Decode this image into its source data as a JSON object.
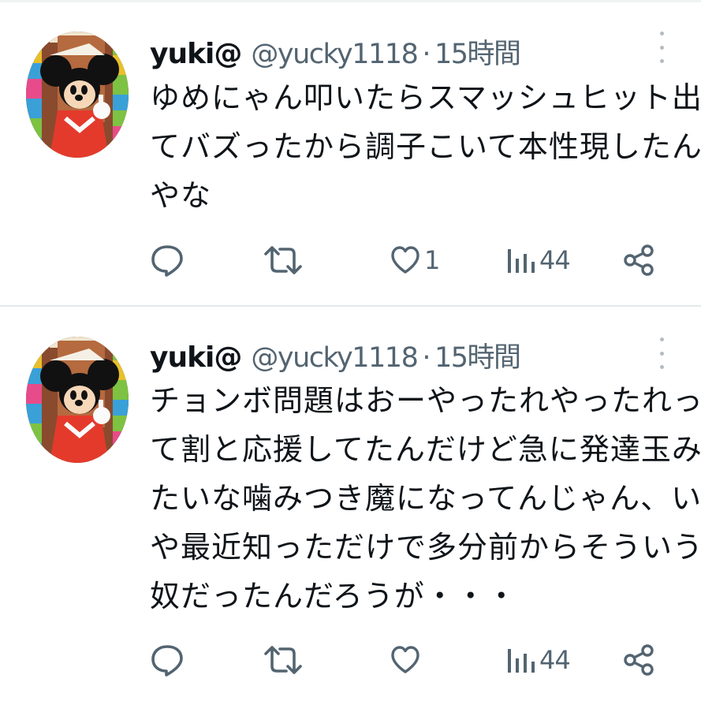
{
  "tweets": [
    {
      "author_name": "yuki@",
      "handle": "@yucky1118",
      "separator": "·",
      "time": "15時間",
      "lines": [
        "ゆめにゃん叩いたらスマッシュヒット出",
        "てバズったから調子こいて本性現したん",
        "やな"
      ],
      "reply_count": "",
      "retweet_count": "",
      "like_count": "1",
      "view_count": "44"
    },
    {
      "author_name": "yuki@",
      "handle": "@yucky1118",
      "separator": "·",
      "time": "15時間",
      "lines": [
        "チョンボ問題はおーやったれやったれっ",
        "て割と応援してたんだけど急に発達玉み",
        "たいな噛みつき魔になってんじゃん、い",
        "や最近知っただけで多分前からそういう",
        "奴だったんだろうが・・・"
      ],
      "reply_count": "",
      "retweet_count": "",
      "like_count": "",
      "view_count": "44"
    }
  ],
  "icons": {
    "reply": "speech-bubble-icon",
    "retweet": "retweet-arrows-icon",
    "like": "heart-icon",
    "views": "bar-chart-icon",
    "share": "share-icon",
    "more": "vertical-dots-icon"
  },
  "colors": {
    "text": "#0f1419",
    "secondary": "#536471",
    "divider": "#e6e9eb",
    "background": "#ffffff"
  }
}
